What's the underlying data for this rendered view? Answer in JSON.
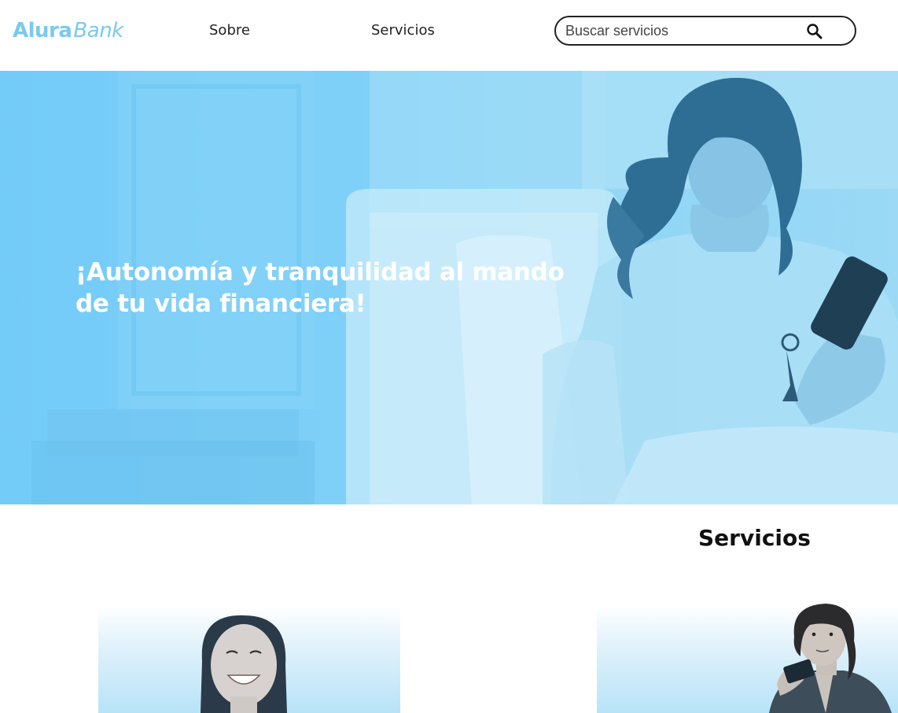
{
  "header": {
    "logo_part1": "Alura",
    "logo_part2": "Bank",
    "nav": [
      {
        "label": "Sobre"
      },
      {
        "label": "Servicios"
      }
    ],
    "search": {
      "placeholder": "Buscar servicios",
      "icon": "search-icon"
    }
  },
  "hero": {
    "title": "¡Autonomía y tranquilidad al mando de tu vida financiera!",
    "image": "woman-using-phone-photo"
  },
  "services": {
    "title": "Servicios",
    "cards": [
      {
        "image": "smiling-woman-photo"
      },
      {
        "image": "man-with-card-photo"
      }
    ]
  },
  "colors": {
    "brand": "#7cc8ef",
    "hero_overlay": "#7fd0f8",
    "text_dark": "#111111"
  }
}
